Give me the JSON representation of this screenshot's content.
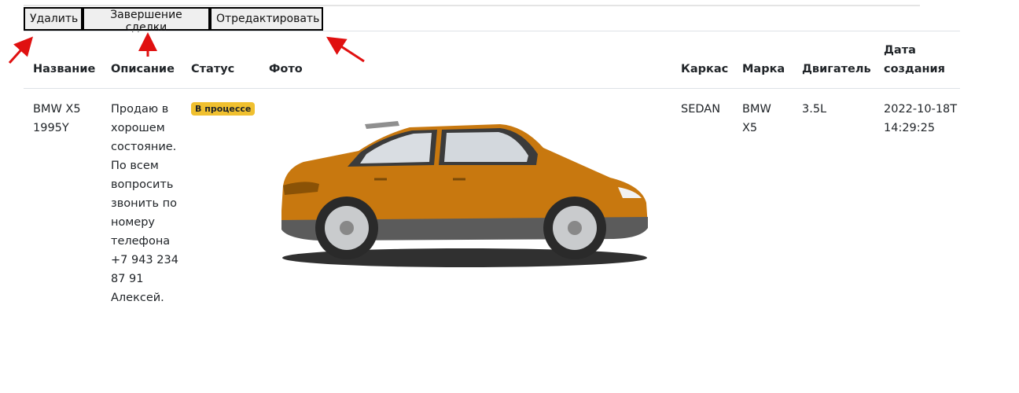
{
  "toolbar": {
    "delete_label": "Удалить",
    "complete_label": "Завершение сделки",
    "edit_label": "Отредактировать"
  },
  "table": {
    "headers": {
      "name": "Название",
      "description": "Описание",
      "status": "Статус",
      "photo": "Фото",
      "body": "Каркас",
      "make": "Марка",
      "engine": "Двигатель",
      "created": "Дата создания"
    },
    "rows": [
      {
        "name": "BMW X5 1995Y",
        "description": "Продаю в хорошем состояние. По всем вопросить звонить по номеру телефона +7 943 234 87 91 Алексей.",
        "status": "В процессе",
        "body": "SEDAN",
        "make": "BMW X5",
        "engine": "3.5L",
        "created": "2022-10-18T14:29:25"
      }
    ]
  },
  "colors": {
    "status_badge": "#f0c02f",
    "arrow": "#e01010",
    "car_body": "#c8780f"
  },
  "icons": {
    "photo": "orange-suv-photo",
    "annotation": "red-arrow"
  }
}
